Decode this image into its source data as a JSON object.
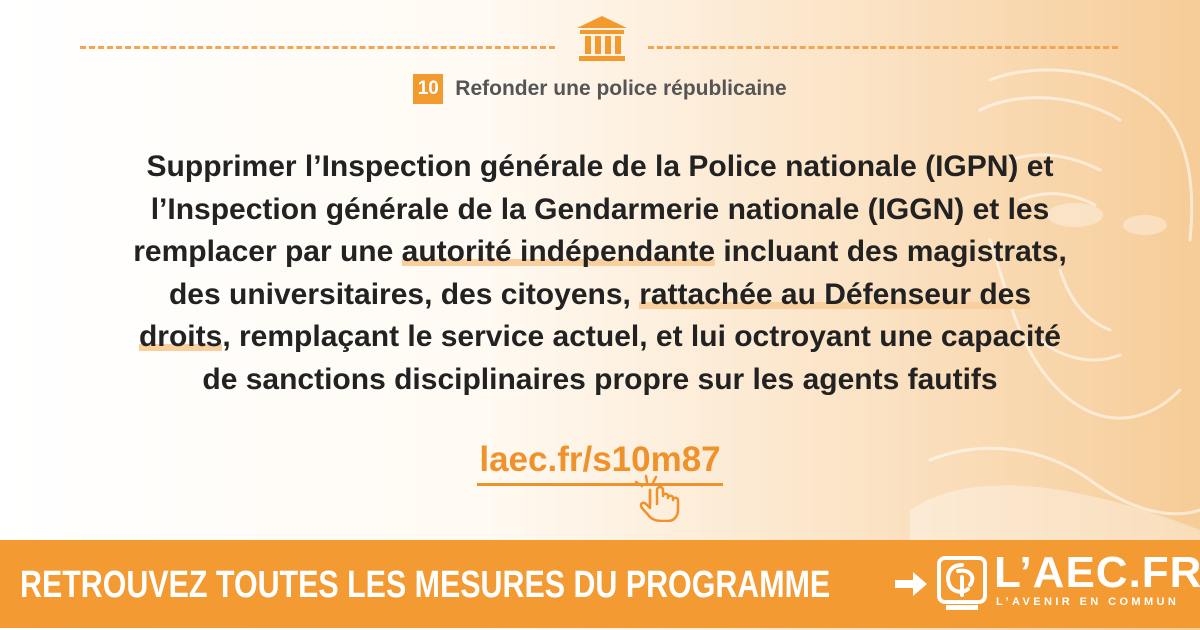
{
  "header": {
    "icon": "building-icon",
    "measure_number": "10",
    "category": "Refonder une police républicaine"
  },
  "measure": {
    "part1": "Supprimer l’Inspection générale de la Police nationale (IGPN) et",
    "part2": "l’Inspection générale de la Gendarmerie nationale (IGGN) et les",
    "part3": "remplacer par une ",
    "highlight1": "autorité indépendante",
    "part4": " incluant des magistrats,",
    "part5": "des universitaires, des citoyens, ",
    "highlight2a": "rattachée au Défenseur des",
    "highlight2b": "droits",
    "part6": ", remplaçant le service actuel, et lui octroyant une capacité",
    "part7": "de sanctions disciplinaires propre sur les agents fautifs"
  },
  "link": {
    "text": "laec.fr/s10m87",
    "icon": "pointer-click-icon"
  },
  "footer": {
    "cta": "RETROUVEZ TOUTES LES MESURES DU PROGRAMME",
    "arrow_icon": "arrow-right-icon",
    "logo_text": "L’AEC.FR",
    "logo_subtitle": "L’AVENIR EN COMMUN"
  },
  "colors": {
    "accent": "#f39a33",
    "highlight": "#f9cf9d",
    "text": "#222222",
    "muted_text": "#555555"
  }
}
